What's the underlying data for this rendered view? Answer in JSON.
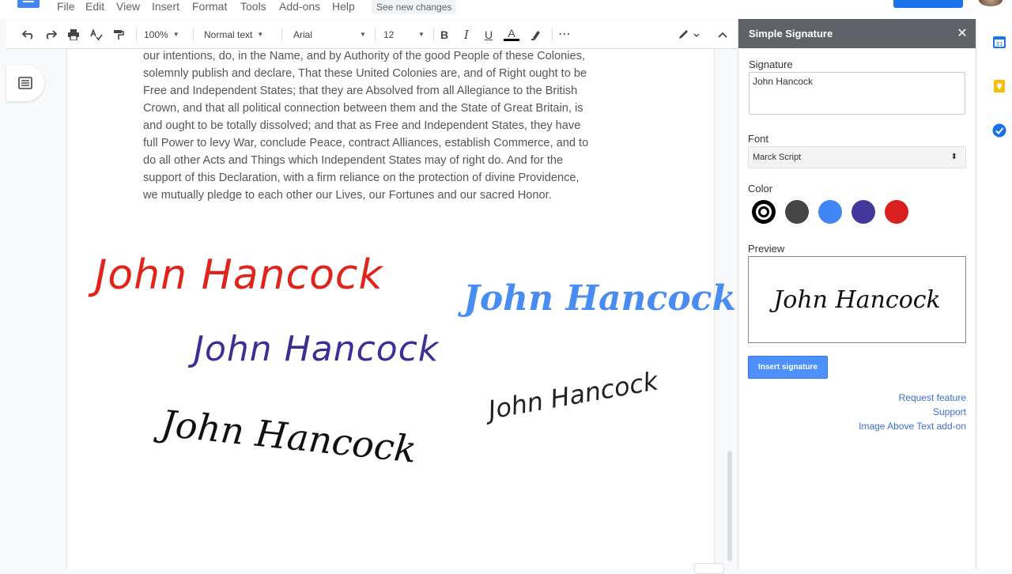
{
  "menubar": {
    "items": [
      "File",
      "Edit",
      "View",
      "Insert",
      "Format",
      "Tools",
      "Add-ons",
      "Help"
    ],
    "see_new_changes": "See new changes"
  },
  "toolbar": {
    "zoom": "100%",
    "style": "Normal text",
    "font": "Arial",
    "font_size": "12",
    "bold": "B",
    "italic": "I",
    "underline": "U",
    "text_color": "A",
    "more": "⋯"
  },
  "document": {
    "lines": [
      "our intentions, do, in the Name, and by Authority of the good People of these Colonies,",
      "solemnly publish and declare, That these United Colonies are, and of Right ought to be",
      "Free and Independent States; that they are Absolved from all Allegiance to the British",
      "Crown, and that all political connection between them and the State of Great Britain, is",
      "and ought to be totally dissolved; and that as Free and Independent States, they have",
      "full Power to levy War, conclude Peace, contract Alliances, establish Commerce, and to",
      "do all other Acts and Things which Independent States may of right do. And for the",
      "support of this Declaration, with a firm reliance on the protection of divine Providence,",
      "we mutually pledge to each other our Lives, our Fortunes and our sacred Honor."
    ],
    "signatures": {
      "red": "John Hancock",
      "blue": "John Hancock",
      "navy": "John Hancock",
      "black_large": "John Hancock",
      "black_small": "John Hancock"
    }
  },
  "sidebar": {
    "title": "Simple Signature",
    "close": "✕",
    "signature_label": "Signature",
    "signature_value": "John Hancock",
    "font_label": "Font",
    "font_value": "Marck Script",
    "color_label": "Color",
    "colors": [
      "#000000",
      "#444444",
      "#4285f4",
      "#45389c",
      "#d9201f"
    ],
    "selected_color": "#000000",
    "preview_label": "Preview",
    "preview_text": "John Hancock",
    "insert_button": "Insert signature",
    "links": [
      "Request feature",
      "Support",
      "Image Above Text add-on"
    ]
  },
  "side_panel": {
    "icons": [
      "calendar-icon",
      "keep-icon",
      "tasks-icon"
    ],
    "colors": [
      "#1a73e8",
      "#fbbc04",
      "#1a73e8"
    ]
  }
}
